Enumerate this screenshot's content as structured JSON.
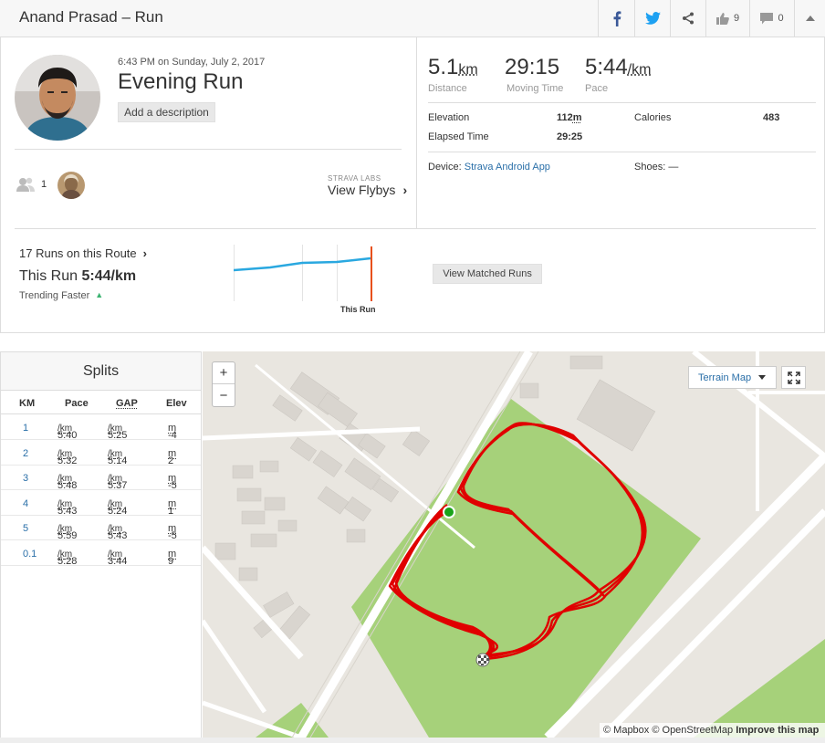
{
  "header": {
    "title": "Anand Prasad – Run",
    "kudos_count": "9",
    "comment_count": "0"
  },
  "activity": {
    "datetime": "6:43 PM on Sunday, July 2, 2017",
    "name": "Evening Run",
    "add_description": "Add a description",
    "athlete_count": "1",
    "flybys_caption": "STRAVA LABS",
    "flybys_link": "View Flybys",
    "flybys_chevron": "›"
  },
  "stats": {
    "distance": {
      "value": "5.1",
      "unit": "km",
      "label": "Distance"
    },
    "moving_time": {
      "value": "29:15",
      "label": "Moving Time"
    },
    "pace": {
      "value": "5:44",
      "unit": "/km",
      "label": "Pace"
    },
    "elevation": {
      "label": "Elevation",
      "value": "112",
      "unit": "m"
    },
    "calories": {
      "label": "Calories",
      "value": "483"
    },
    "elapsed": {
      "label": "Elapsed Time",
      "value": "29:25"
    },
    "device_label": "Device:",
    "device_value": "Strava Android App",
    "shoes_label": "Shoes:",
    "shoes_value": "—"
  },
  "route": {
    "runs_link": "17 Runs on this Route",
    "runs_chevron": "›",
    "this_run_label": "This Run",
    "this_run_pace": "5:44/km",
    "trend": "Trending Faster",
    "trend_arrow": "▲",
    "chart_label": "This Run",
    "view_matched": "View Matched Runs"
  },
  "splits": {
    "title": "Splits",
    "columns": [
      "KM",
      "Pace",
      "GAP",
      "Elev"
    ],
    "rows": [
      {
        "km": "1",
        "pace": "5:40",
        "gap": "5:25",
        "elev": "-4"
      },
      {
        "km": "2",
        "pace": "5:32",
        "gap": "5:14",
        "elev": "2"
      },
      {
        "km": "3",
        "pace": "5:48",
        "gap": "5:37",
        "elev": "-5"
      },
      {
        "km": "4",
        "pace": "5:43",
        "gap": "5:24",
        "elev": "1"
      },
      {
        "km": "5",
        "pace": "5:59",
        "gap": "5:43",
        "elev": "-5"
      },
      {
        "km": "0.1",
        "pace": "5:28",
        "gap": "3:44",
        "elev": "9"
      }
    ],
    "pace_unit": "/km",
    "elev_unit": "m"
  },
  "map": {
    "zoom_in": "+",
    "zoom_out": "−",
    "terrain_label": "Terrain Map",
    "attribution": "© Mapbox © OpenStreetMap",
    "improve": "Improve this map"
  },
  "colors": {
    "strava_link": "#2a6fa8",
    "trend_green": "#3cb371",
    "route_red": "#e00000",
    "park_green": "#a6d17a",
    "chart_blue": "#2aa8e0",
    "chart_marker": "#e8501a"
  }
}
